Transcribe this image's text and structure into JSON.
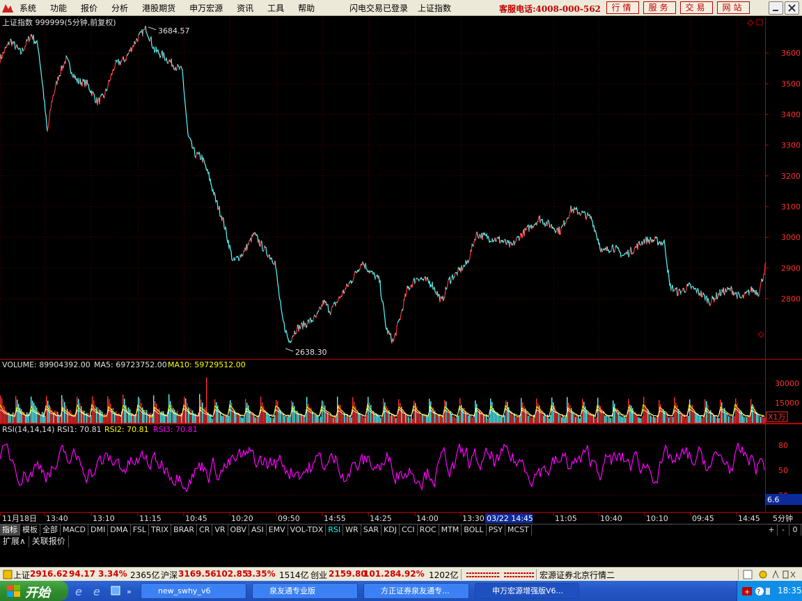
{
  "menu": {
    "items": [
      "系统",
      "功能",
      "报价",
      "分析",
      "港股期货",
      "申万宏源",
      "资讯",
      "工具",
      "帮助"
    ],
    "login_status": "闪电交易已登录",
    "current_security": "上证指数",
    "hotline": "客服电话:4008-000-562",
    "buttons": [
      "行情",
      "服务",
      "交易",
      "网站"
    ]
  },
  "chart_header": "上证指数 999999(5分钟,前复权)",
  "volume_header": {
    "label": "VOLUME: 89904392.00",
    "ma5": "MA5: 69723752.00",
    "ma10": "MA10: 59729512.00"
  },
  "rsi_header": {
    "label": "RSI(14,14,14)",
    "rsi1": "RSI1: 70.81",
    "rsi2": "RSI2: 70.81",
    "rsi3": "RSI3: 70.81"
  },
  "rsi_value_box": "6.6",
  "unit_tag": "X1万",
  "period_label": "5分钟",
  "time_axis": {
    "labels": [
      "11月18日",
      "13:40",
      "13:10",
      "11:15",
      "10:45",
      "10:20",
      "09:50",
      "14:55",
      "14:25",
      "14:00",
      "13:30",
      "11:05",
      "10:40",
      "10:10",
      "09:45",
      "14:45"
    ],
    "highlight": "03/22 14:45"
  },
  "indicator_tabs": [
    "指标",
    "模板",
    "全部"
  ],
  "indicators": [
    "MACD",
    "DMI",
    "DMA",
    "FSL",
    "TRIX",
    "BRAR",
    "CR",
    "VR",
    "OBV",
    "ASI",
    "EMV",
    "VOL-TDX",
    "RSI",
    "WR",
    "SAR",
    "KDJ",
    "CCI",
    "ROC",
    "MTM",
    "BOLL",
    "PSY",
    "MCST"
  ],
  "active_indicator": "RSI",
  "ext_tabs": [
    "扩展∧",
    "关联报价"
  ],
  "nav_controls": [
    "+",
    "-",
    "0"
  ],
  "status": {
    "sh_label": "上证",
    "sh_price": "2916.62",
    "sh_change": "94.17",
    "sh_pct": "3.34%",
    "sh_amount": "2365亿",
    "hs_label": "沪深",
    "hs_price": "3169.56",
    "hs_change": "102.85",
    "hs_pct": "3.35%",
    "hs_amount": "1514亿",
    "cy_label": "创业",
    "cy_price": "2159.80",
    "cy_change": "101.28",
    "cy_pct": "4.92%",
    "cy_amount": "1202亿",
    "server": "宏源证券北京行情二"
  },
  "taskbar": {
    "start": "开始",
    "tasks": [
      "new_swhy_v6",
      "泉友通专业版",
      "方正证券泉友通专...",
      "申万宏源增强版V6..."
    ],
    "clock": "18:35"
  },
  "colors": {
    "up": "#ff3030",
    "down": "#54ffff",
    "grid": "#7a0000",
    "axis": "#c00000",
    "vol_yellow": "#ffff00",
    "rsi": "#ff00ff"
  },
  "chart_data": [
    {
      "type": "line",
      "title": "上证指数 999999(5分钟,前复权)",
      "y_ticks": [
        3600,
        3500,
        3400,
        3300,
        3200,
        3100,
        3000,
        2900,
        2800
      ],
      "ylim": [
        2620,
        3700
      ],
      "annotations": [
        {
          "label": "3684.57",
          "value": 3684.57
        },
        {
          "label": "2638.30",
          "value": 2638.3
        }
      ],
      "anchors": [
        [
          0,
          3580
        ],
        [
          15,
          3640
        ],
        [
          30,
          3600
        ],
        [
          45,
          3660
        ],
        [
          55,
          3620
        ],
        [
          62,
          3480
        ],
        [
          68,
          3340
        ],
        [
          75,
          3450
        ],
        [
          85,
          3530
        ],
        [
          95,
          3580
        ],
        [
          110,
          3510
        ],
        [
          125,
          3500
        ],
        [
          140,
          3440
        ],
        [
          150,
          3460
        ],
        [
          165,
          3560
        ],
        [
          180,
          3580
        ],
        [
          195,
          3640
        ],
        [
          210,
          3680
        ],
        [
          222,
          3610
        ],
        [
          235,
          3590
        ],
        [
          250,
          3560
        ],
        [
          262,
          3540
        ],
        [
          270,
          3330
        ],
        [
          280,
          3270
        ],
        [
          290,
          3260
        ],
        [
          300,
          3200
        ],
        [
          310,
          3120
        ],
        [
          320,
          3060
        ],
        [
          335,
          2920
        ],
        [
          350,
          2950
        ],
        [
          365,
          3010
        ],
        [
          380,
          2960
        ],
        [
          395,
          2920
        ],
        [
          405,
          2740
        ],
        [
          415,
          2660
        ],
        [
          425,
          2700
        ],
        [
          440,
          2720
        ],
        [
          455,
          2740
        ],
        [
          465,
          2790
        ],
        [
          475,
          2760
        ],
        [
          490,
          2810
        ],
        [
          505,
          2860
        ],
        [
          520,
          2920
        ],
        [
          535,
          2880
        ],
        [
          545,
          2860
        ],
        [
          555,
          2700
        ],
        [
          565,
          2660
        ],
        [
          575,
          2740
        ],
        [
          585,
          2830
        ],
        [
          600,
          2870
        ],
        [
          620,
          2850
        ],
        [
          635,
          2790
        ],
        [
          645,
          2860
        ],
        [
          660,
          2890
        ],
        [
          672,
          2920
        ],
        [
          684,
          3010
        ],
        [
          700,
          3000
        ],
        [
          720,
          2990
        ],
        [
          735,
          2970
        ],
        [
          745,
          3000
        ],
        [
          760,
          3030
        ],
        [
          775,
          3060
        ],
        [
          790,
          3040
        ],
        [
          805,
          3020
        ],
        [
          820,
          3090
        ],
        [
          835,
          3080
        ],
        [
          850,
          3060
        ],
        [
          865,
          2950
        ],
        [
          880,
          2970
        ],
        [
          895,
          2940
        ],
        [
          910,
          2960
        ],
        [
          925,
          2990
        ],
        [
          940,
          2990
        ],
        [
          955,
          2980
        ],
        [
          962,
          2840
        ],
        [
          975,
          2820
        ],
        [
          990,
          2840
        ],
        [
          1005,
          2820
        ],
        [
          1020,
          2790
        ],
        [
          1035,
          2820
        ],
        [
          1050,
          2830
        ],
        [
          1065,
          2800
        ],
        [
          1080,
          2830
        ],
        [
          1090,
          2820
        ],
        [
          1100,
          2910
        ]
      ]
    },
    {
      "type": "bar",
      "title": "VOLUME",
      "y_ticks": [
        30000,
        15000
      ],
      "unit": "X1万",
      "series": [
        {
          "name": "VOLUME"
        },
        {
          "name": "MA5"
        },
        {
          "name": "MA10"
        }
      ]
    },
    {
      "type": "line",
      "title": "RSI(14,14,14)",
      "y_ticks": [
        80.0,
        50.0,
        20.0
      ],
      "ylim": [
        0,
        100
      ],
      "series": [
        {
          "name": "RSI1",
          "last": 70.81
        },
        {
          "name": "RSI2",
          "last": 70.81
        },
        {
          "name": "RSI3",
          "last": 70.81
        }
      ]
    }
  ]
}
